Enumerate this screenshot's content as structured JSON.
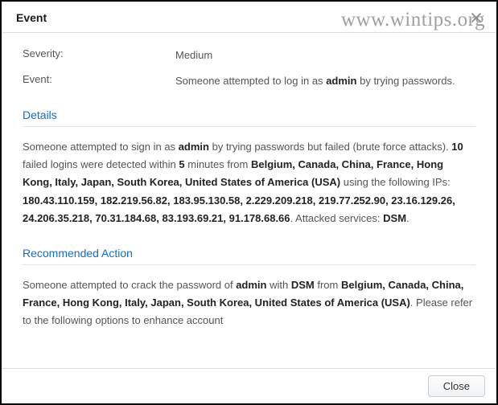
{
  "header": {
    "title": "Event",
    "close_icon_name": "close-icon"
  },
  "watermark": "www.wintips.org",
  "summary": {
    "severity_label": "Severity:",
    "severity_value": "Medium",
    "event_label": "Event:",
    "event_text_pre": "Someone attempted to log in as ",
    "event_bold_user": "admin",
    "event_text_post": " by trying passwords."
  },
  "details": {
    "heading": "Details",
    "text_1": "Someone attempted to sign in as ",
    "bold_user": "admin",
    "text_2": " by trying passwords but failed (brute force attacks). ",
    "bold_failed_count": "10",
    "text_3": " failed logins were detected within ",
    "bold_minutes": "5",
    "text_4": " minutes from ",
    "bold_countries": "Belgium, Canada, China, France, Hong Kong, Italy, Japan, South Korea, United States of America (USA)",
    "text_5": " using the following IPs: ",
    "bold_ips": "180.43.110.159, 182.219.56.82, 183.95.130.58, 2.229.209.218, 219.77.252.90, 23.16.129.26, 24.206.35.218, 70.31.184.68, 83.193.69.21, 91.178.68.66",
    "text_6": ". Attacked services: ",
    "bold_service": "DSM",
    "text_7": "."
  },
  "recommended": {
    "heading": "Recommended Action",
    "text_1": "Someone attempted to crack the password of ",
    "bold_user": "admin",
    "text_2": " with ",
    "bold_service": "DSM",
    "text_3": " from ",
    "bold_countries": "Belgium, Canada, China, France, Hong Kong, Italy, Japan, South Korea, United States of America (USA)",
    "text_4": ". Please refer to the following options to enhance account"
  },
  "footer": {
    "close_label": "Close"
  }
}
